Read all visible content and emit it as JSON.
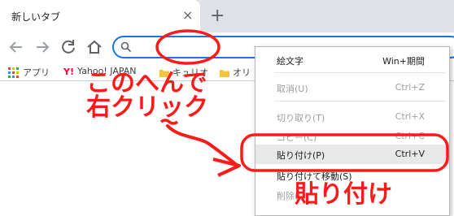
{
  "tab": {
    "title": "新しいタブ",
    "close_glyph": "×",
    "new_tab_glyph": "+"
  },
  "toolbar": {
    "search_placeholder": ""
  },
  "bookmarks": [
    {
      "label": "アプリ",
      "icon": "apps-grid-icon"
    },
    {
      "label": "Yahoo! JAPAN",
      "icon": "yahoo-y-icon"
    },
    {
      "label": "キュリオ",
      "icon": "folder-icon"
    },
    {
      "label": "オリ",
      "icon": "folder-icon"
    }
  ],
  "context_menu": {
    "items": [
      {
        "label": "絵文字",
        "shortcut": "Win+期間",
        "state": "enabled"
      },
      {
        "label": "取消(U)",
        "shortcut": "Ctrl+Z",
        "state": "disabled"
      },
      {
        "label": "切り取り(T)",
        "shortcut": "Ctrl+X",
        "state": "disabled"
      },
      {
        "label": "コピー(C)",
        "shortcut": "Ctrl+C",
        "state": "disabled"
      },
      {
        "label": "貼り付け(P)",
        "shortcut": "Ctrl+V",
        "state": "hover"
      },
      {
        "label": "貼り付けて移動(S)",
        "shortcut": "",
        "state": "enabled"
      },
      {
        "label": "削除(D)",
        "shortcut": "",
        "state": "disabled"
      }
    ]
  },
  "annotations": {
    "line1": "このへんで",
    "line2": "右クリック",
    "paste": "貼り付け",
    "color": "#ff1a1a"
  },
  "colors": {
    "omnibox_focus": "#1a73e8",
    "annotation": "#ff1a1a"
  }
}
